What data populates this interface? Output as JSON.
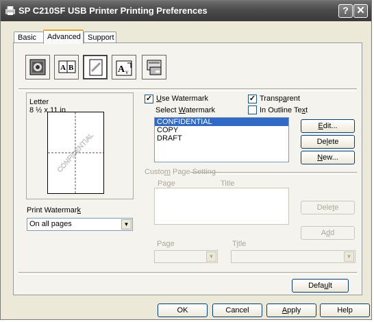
{
  "window": {
    "title": "SP C210SF USB Printer Printing Preferences",
    "help_btn": "?",
    "close_btn": "✕"
  },
  "tabs": [
    {
      "label": "Basic"
    },
    {
      "label": "Advanced",
      "active": true
    },
    {
      "label": "Support"
    }
  ],
  "toolbar_icons": [
    "quality-icon",
    "duplex-icon",
    "watermark-icon",
    "page-setting-icon",
    "device-options-icon"
  ],
  "preview": {
    "paper_label": "Letter",
    "paper_size": "8 ½ x 11 in",
    "watermark_text": "CONFIDENTIAL"
  },
  "print_watermark": {
    "label_pre": "Print Watermar",
    "label_u": "k",
    "label_post": "",
    "value": "On all pages"
  },
  "use_watermark": {
    "label_pre": "",
    "label_u": "U",
    "label_post": "se Watermark",
    "checked": true
  },
  "transparent": {
    "label_pre": "Transp",
    "label_u": "a",
    "label_post": "rent",
    "checked": true
  },
  "select_watermark": {
    "label_pre": "Select ",
    "label_u": "W",
    "label_post": "atermark"
  },
  "in_outline": {
    "label_pre": "In Outline Te",
    "label_u": "x",
    "label_post": "t",
    "checked": false
  },
  "watermark_list": [
    "CONFIDENTIAL",
    "COPY",
    "DRAFT"
  ],
  "selected_index": 0,
  "buttons": {
    "edit": {
      "pre": "",
      "u": "E",
      "post": "dit..."
    },
    "delete": {
      "pre": "De",
      "u": "l",
      "post": "ete"
    },
    "new": {
      "pre": "",
      "u": "N",
      "post": "ew..."
    },
    "custom_delete": {
      "pre": "Dele",
      "u": "t",
      "post": "e"
    },
    "custom_add": {
      "pre": "A",
      "u": "d",
      "post": "d"
    },
    "default": {
      "pre": "Defa",
      "u": "u",
      "post": "lt"
    },
    "ok": {
      "pre": "OK",
      "u": "",
      "post": ""
    },
    "cancel": {
      "pre": "Cancel",
      "u": "",
      "post": ""
    },
    "apply": {
      "pre": "",
      "u": "A",
      "post": "pply"
    },
    "help": {
      "pre": "Help",
      "u": "",
      "post": ""
    }
  },
  "custom_page": {
    "group_label_pre": "Custo",
    "group_label_u": "m",
    "group_label_post": " Page Setting",
    "col_page": "Page",
    "col_title": "Title",
    "page_label": "Page",
    "title_label_pre": "T",
    "title_label_u": "i",
    "title_label_post": "tle"
  },
  "colors": {
    "selection": "#316ac5",
    "titlebar": "#4b4b4b",
    "dialog_bg": "#ece9d8"
  }
}
